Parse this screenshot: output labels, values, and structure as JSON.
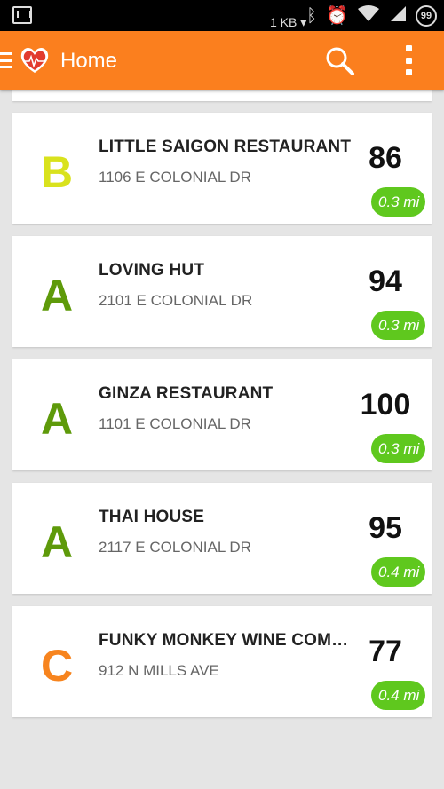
{
  "status_bar": {
    "data_rate": "1 KB ▾",
    "battery": "99"
  },
  "app_bar": {
    "title": "Home"
  },
  "colors": {
    "primary": "#fb7f1e",
    "distance_pill": "#5fc81e",
    "grade_A": "#5e9a0a",
    "grade_B": "#d9e21d",
    "grade_C": "#f7841e"
  },
  "restaurants": [
    {
      "grade": "B",
      "name": "LITTLE SAIGON RESTAURANT",
      "address": "1106 E COLONIAL DR",
      "score": "86",
      "distance": "0.3 mi"
    },
    {
      "grade": "A",
      "name": "LOVING HUT",
      "address": "2101 E COLONIAL DR",
      "score": "94",
      "distance": "0.3 mi"
    },
    {
      "grade": "A",
      "name": "GINZA RESTAURANT",
      "address": "1101 E COLONIAL DR",
      "score": "100",
      "distance": "0.3 mi"
    },
    {
      "grade": "A",
      "name": "THAI HOUSE",
      "address": "2117 E COLONIAL DR",
      "score": "95",
      "distance": "0.4 mi"
    },
    {
      "grade": "C",
      "name": "FUNKY MONKEY WINE COMPANY",
      "address": "912 N MILLS AVE",
      "score": "77",
      "distance": "0.4 mi"
    }
  ]
}
